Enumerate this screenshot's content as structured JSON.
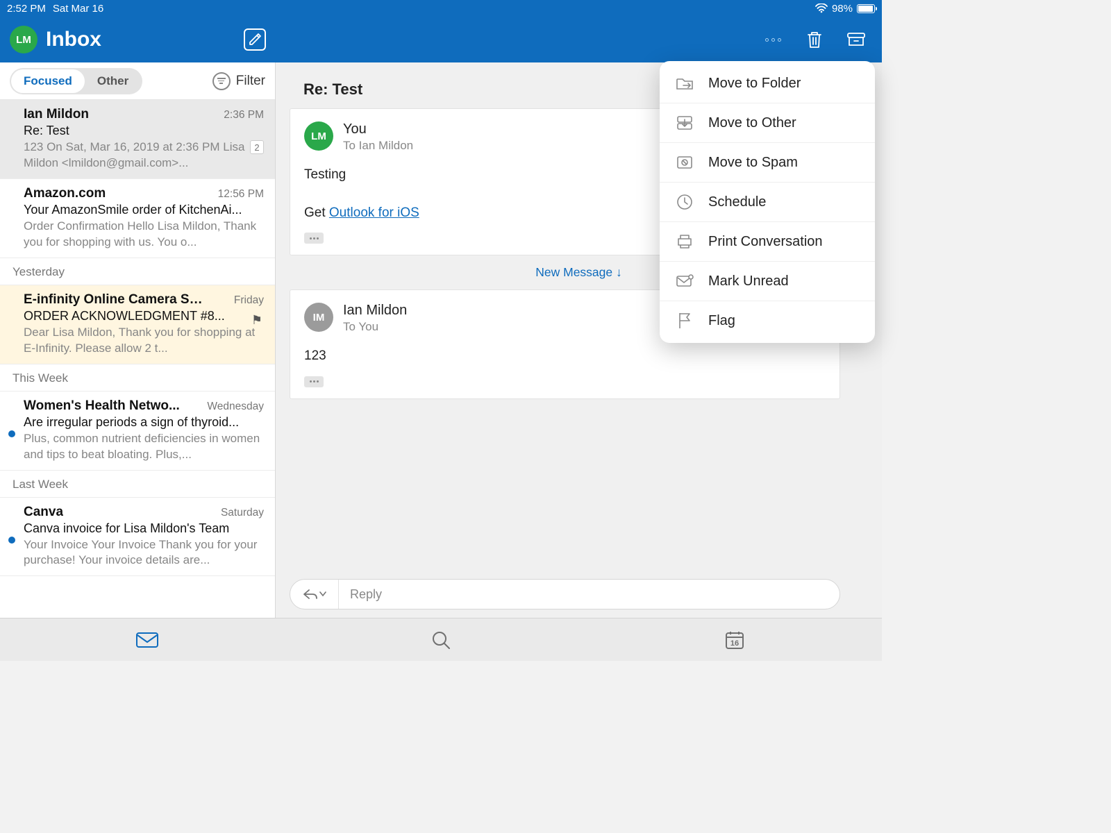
{
  "status": {
    "time": "2:52 PM",
    "date": "Sat Mar 16",
    "battery": "98%"
  },
  "header": {
    "avatar_initials": "LM",
    "title": "Inbox"
  },
  "toolbar": {
    "seg_focused": "Focused",
    "seg_other": "Other",
    "filter": "Filter"
  },
  "sections": [
    "Yesterday",
    "This Week",
    "Last Week"
  ],
  "items": [
    {
      "sender": "Ian Mildon",
      "time": "2:36 PM",
      "subject": "Re: Test",
      "preview": "123 On Sat, Mar 16, 2019 at 2:36 PM Lisa Mildon <lmildon@gmail.com>...",
      "count": "2"
    },
    {
      "sender": "Amazon.com",
      "time": "12:56 PM",
      "subject": "Your AmazonSmile order of KitchenAi...",
      "preview": "Order Confirmation Hello Lisa Mildon, Thank you for shopping with us. You o..."
    },
    {
      "sender": "E-infinity Online Camera St...",
      "time": "Friday",
      "subject": "ORDER ACKNOWLEDGMENT #8...",
      "preview": "Dear Lisa Mildon, Thank you for shopping at E-Infinity. Please allow 2 t..."
    },
    {
      "sender": "Women's Health Netwo...",
      "time": "Wednesday",
      "subject": "Are irregular periods a sign of thyroid...",
      "preview": "Plus, common nutrient deficiencies in women and tips to beat bloating. Plus,..."
    },
    {
      "sender": "Canva",
      "time": "Saturday",
      "subject": "Canva invoice for Lisa Mildon's Team",
      "preview": "Your Invoice Your Invoice Thank you for your purchase! Your invoice details are..."
    }
  ],
  "thread": {
    "subject": "Re: Test",
    "messages": [
      {
        "avatar": "LM",
        "avatar_color": "#2aa84a",
        "from": "You",
        "to": "To Ian Mildon",
        "body_prefix": "Testing",
        "body_line2_a": "Get ",
        "body_link": "Outlook for iOS"
      },
      {
        "avatar": "IM",
        "avatar_color": "#9b9b9b",
        "from": "Ian Mildon",
        "to": "To You",
        "body_prefix": "123"
      }
    ],
    "new_msg": "New Message  ↓"
  },
  "reply_placeholder": "Reply",
  "popover": {
    "items": [
      "Move to Folder",
      "Move to Other",
      "Move to Spam",
      "Schedule",
      "Print Conversation",
      "Mark Unread",
      "Flag"
    ]
  },
  "calendar_day": "16"
}
